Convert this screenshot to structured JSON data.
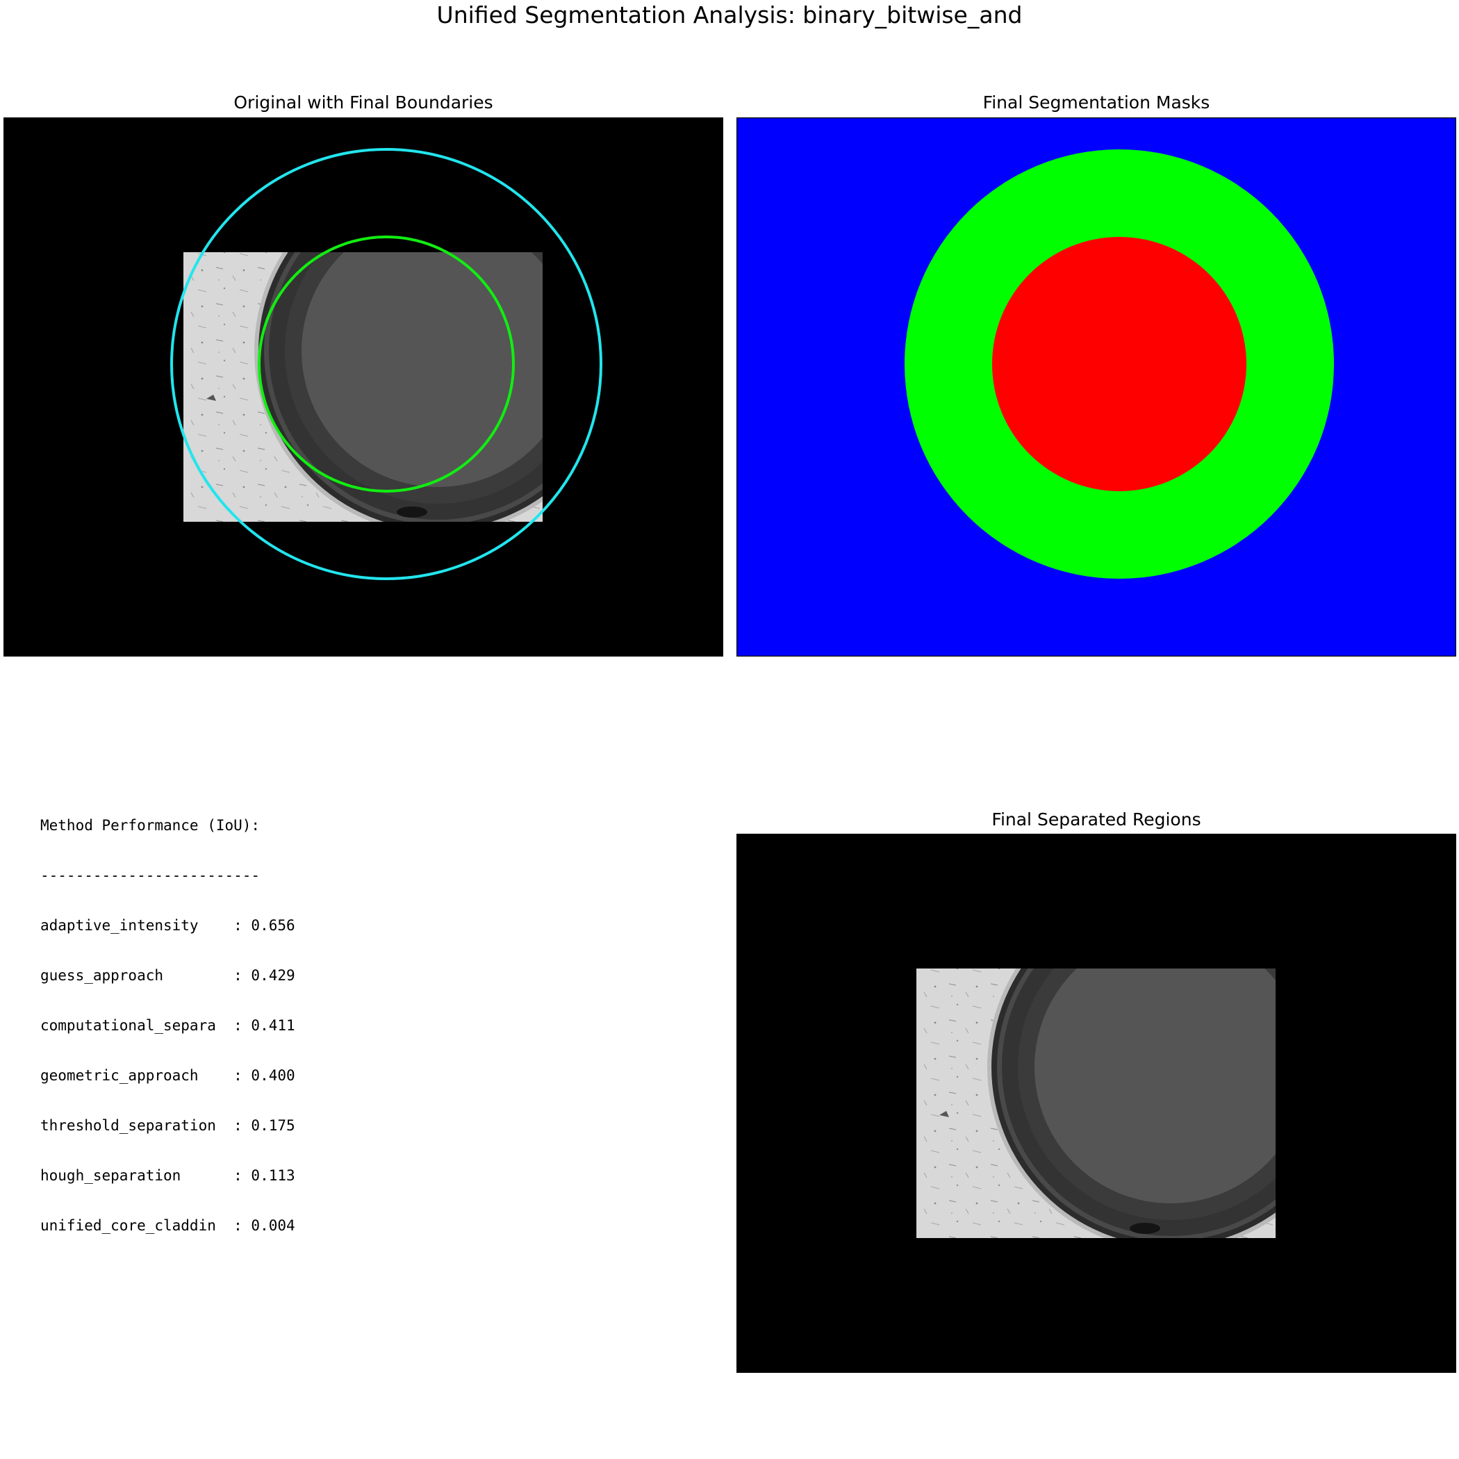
{
  "figure": {
    "title": "Unified Segmentation Analysis: binary_bitwise_and"
  },
  "panels": {
    "original": {
      "title": "Original with Final Boundaries"
    },
    "masks": {
      "title": "Final Segmentation Masks",
      "colors": {
        "background": "#0000ff",
        "cladding": "#00ff00",
        "core": "#ff0000"
      }
    },
    "regions": {
      "title": "Final Separated Regions"
    }
  },
  "boundary_colors": {
    "outer": "#22e5ee",
    "inner": "#11ee11"
  },
  "performance": {
    "header": "Method Performance (IoU):",
    "rule": "-------------------------",
    "rows": [
      "adaptive_intensity    : 0.656",
      "guess_approach        : 0.429",
      "computational_separa  : 0.411",
      "geometric_approach    : 0.400",
      "threshold_separation  : 0.175",
      "hough_separation      : 0.113",
      "unified_core_claddin  : 0.004"
    ]
  }
}
